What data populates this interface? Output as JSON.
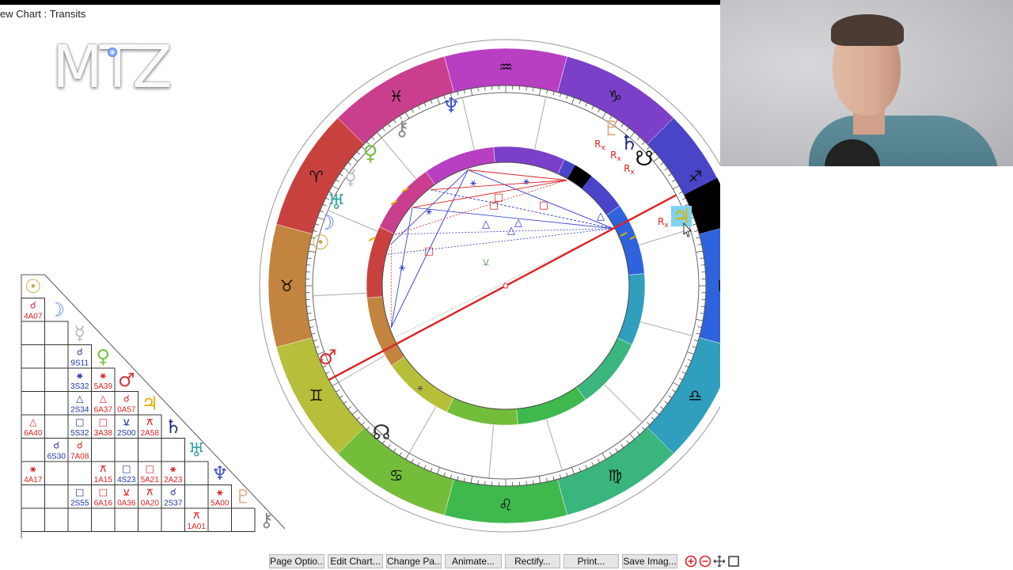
{
  "window": {
    "title": "ew Chart : Transits"
  },
  "logo": {
    "text": "MTZ"
  },
  "toolbar": {
    "buttons": [
      {
        "id": "page-options",
        "label": "Page Optio..."
      },
      {
        "id": "edit-chart",
        "label": "Edit Chart..."
      },
      {
        "id": "change-page",
        "label": "Change Pa..."
      },
      {
        "id": "animate",
        "label": "Animate..."
      },
      {
        "id": "rectify",
        "label": "Rectify..."
      },
      {
        "id": "print",
        "label": "Print..."
      },
      {
        "id": "save-image",
        "label": "Save Imag..."
      }
    ],
    "zoom_icons": [
      "zoom-in-icon",
      "zoom-out-icon",
      "pan-icon",
      "fit-icon"
    ]
  },
  "zodiac": {
    "signs": [
      {
        "name": "aquarius",
        "glyph": "♒",
        "color": "#b83fc2"
      },
      {
        "name": "capricorn",
        "glyph": "♑",
        "color": "#7b3fc8"
      },
      {
        "name": "sagittarius",
        "glyph": "♐",
        "color": "#4a44c9"
      },
      {
        "name": "scorpio",
        "glyph": "♏",
        "color": "#2f63dd"
      },
      {
        "name": "libra",
        "glyph": "♎",
        "color": "#2f9fbd"
      },
      {
        "name": "virgo",
        "glyph": "♍",
        "color": "#3bb57e"
      },
      {
        "name": "leo",
        "glyph": "♌",
        "color": "#3fb84e"
      },
      {
        "name": "cancer",
        "glyph": "♋",
        "color": "#73bd3a"
      },
      {
        "name": "gemini",
        "glyph": "♊",
        "color": "#b7bf3a"
      },
      {
        "name": "taurus",
        "glyph": "♉",
        "color": "#c2843f"
      },
      {
        "name": "aries",
        "glyph": "♈",
        "color": "#c9413f"
      },
      {
        "name": "pisces",
        "glyph": "♓",
        "color": "#c93f8e"
      }
    ],
    "uranus_glyph": "♅"
  },
  "transit_planets": [
    {
      "name": "neptune",
      "glyph": "♆",
      "color": "#3c56c8"
    },
    {
      "name": "chiron",
      "glyph": "⚷",
      "color": "#888888"
    },
    {
      "name": "venus",
      "glyph": "♀",
      "color": "#7bc043"
    },
    {
      "name": "mercury",
      "glyph": "☿",
      "color": "#bbbbbb"
    },
    {
      "name": "uranus",
      "glyph": "♅",
      "color": "#3aa7a2"
    },
    {
      "name": "moon",
      "glyph": "☽",
      "color": "#5c8be0"
    },
    {
      "name": "sun",
      "glyph": "☉",
      "color": "#c9a23a"
    },
    {
      "name": "mars",
      "glyph": "♂",
      "color": "#d23a3a"
    },
    {
      "name": "node",
      "glyph": "☊",
      "color": "#333333"
    },
    {
      "name": "pluto",
      "glyph": "♇",
      "color": "#e0b08a"
    },
    {
      "name": "saturn",
      "glyph": "♄",
      "color": "#1e2a7a"
    },
    {
      "name": "south-node",
      "glyph": "☋",
      "color": "#111111"
    },
    {
      "name": "jupiter",
      "glyph": "♃",
      "color": "#e0b000"
    }
  ],
  "retrograde_label": "R",
  "retrograde_sub": "x",
  "aspect_grid": {
    "planets": [
      {
        "glyph": "☉",
        "color": "#c9a23a"
      },
      {
        "glyph": "☽",
        "color": "#5c8be0"
      },
      {
        "glyph": "☿",
        "color": "#bbbbbb"
      },
      {
        "glyph": "♀",
        "color": "#7bc043"
      },
      {
        "glyph": "♂",
        "color": "#d23a3a"
      },
      {
        "glyph": "♃",
        "color": "#e0b000"
      },
      {
        "glyph": "♄",
        "color": "#1e2a7a"
      },
      {
        "glyph": "♅",
        "color": "#3aa7a2"
      },
      {
        "glyph": "♆",
        "color": "#3c56c8"
      },
      {
        "glyph": "♇",
        "color": "#e0b08a"
      },
      {
        "glyph": "⚷",
        "color": "#888888"
      }
    ],
    "cells": [
      {
        "r": 1,
        "c": 0,
        "sym": "☌",
        "txt": "4A07",
        "col": "#d22"
      },
      {
        "r": 3,
        "c": 2,
        "sym": "☌",
        "txt": "9S11",
        "col": "#23a"
      },
      {
        "r": 4,
        "c": 2,
        "sym": "⚹",
        "txt": "3S32",
        "col": "#23a"
      },
      {
        "r": 4,
        "c": 3,
        "sym": "⚹",
        "txt": "5A39",
        "col": "#d22"
      },
      {
        "r": 5,
        "c": 2,
        "sym": "△",
        "txt": "2S34",
        "col": "#23a"
      },
      {
        "r": 5,
        "c": 3,
        "sym": "△",
        "txt": "6A37",
        "col": "#d22"
      },
      {
        "r": 5,
        "c": 4,
        "sym": "☌",
        "txt": "0A57",
        "col": "#d22"
      },
      {
        "r": 6,
        "c": 0,
        "sym": "△",
        "txt": "6A40",
        "col": "#d22"
      },
      {
        "r": 6,
        "c": 2,
        "sym": "□",
        "txt": "5S32",
        "col": "#23a"
      },
      {
        "r": 6,
        "c": 3,
        "sym": "□",
        "txt": "3A38",
        "col": "#d22"
      },
      {
        "r": 6,
        "c": 4,
        "sym": "⚺",
        "txt": "2S00",
        "col": "#23a"
      },
      {
        "r": 6,
        "c": 5,
        "sym": "⚻",
        "txt": "2A58",
        "col": "#d22"
      },
      {
        "r": 7,
        "c": 1,
        "sym": "☌",
        "txt": "6S30",
        "col": "#23a"
      },
      {
        "r": 7,
        "c": 2,
        "sym": "☌",
        "txt": "7A08",
        "col": "#d22"
      },
      {
        "r": 8,
        "c": 0,
        "sym": "⚹",
        "txt": "4A17",
        "col": "#d22"
      },
      {
        "r": 8,
        "c": 3,
        "sym": "⚻",
        "txt": "1A15",
        "col": "#d22"
      },
      {
        "r": 8,
        "c": 4,
        "sym": "□",
        "txt": "4S23",
        "col": "#23a"
      },
      {
        "r": 8,
        "c": 5,
        "sym": "□",
        "txt": "5A21",
        "col": "#d22"
      },
      {
        "r": 8,
        "c": 6,
        "sym": "⚹",
        "txt": "2A23",
        "col": "#d22"
      },
      {
        "r": 9,
        "c": 2,
        "sym": "□",
        "txt": "2S55",
        "col": "#23a"
      },
      {
        "r": 9,
        "c": 3,
        "sym": "□",
        "txt": "6A16",
        "col": "#d22"
      },
      {
        "r": 9,
        "c": 4,
        "sym": "⚺",
        "txt": "0A36",
        "col": "#d22"
      },
      {
        "r": 9,
        "c": 5,
        "sym": "⚻",
        "txt": "0A20",
        "col": "#d22"
      },
      {
        "r": 9,
        "c": 6,
        "sym": "☌",
        "txt": "2S37",
        "col": "#23a"
      },
      {
        "r": 9,
        "c": 8,
        "sym": "⚹",
        "txt": "5A00",
        "col": "#d22"
      },
      {
        "r": 10,
        "c": 7,
        "sym": "⚻",
        "txt": "1A01",
        "col": "#d22"
      }
    ]
  }
}
